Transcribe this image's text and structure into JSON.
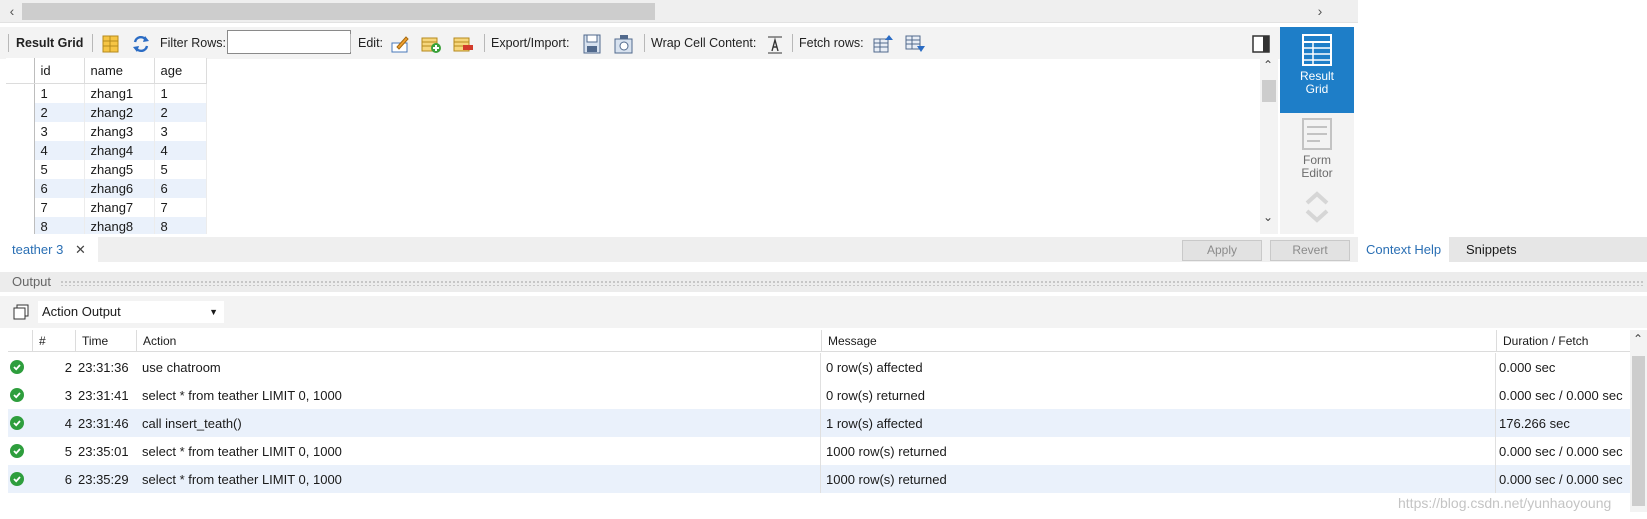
{
  "toolbar": {
    "result_grid": "Result Grid",
    "filter_rows": "Filter Rows:",
    "filter_value": "",
    "edit": "Edit:",
    "export_import": "Export/Import:",
    "wrap_cell": "Wrap Cell Content:",
    "fetch_rows": "Fetch rows:"
  },
  "grid": {
    "columns": [
      "id",
      "name",
      "age"
    ],
    "rows": [
      [
        "1",
        "zhang1",
        "1"
      ],
      [
        "2",
        "zhang2",
        "2"
      ],
      [
        "3",
        "zhang3",
        "3"
      ],
      [
        "4",
        "zhang4",
        "4"
      ],
      [
        "5",
        "zhang5",
        "5"
      ],
      [
        "6",
        "zhang6",
        "6"
      ],
      [
        "7",
        "zhang7",
        "7"
      ],
      [
        "8",
        "zhang8",
        "8"
      ]
    ]
  },
  "side_panel": {
    "result_grid_line1": "Result",
    "result_grid_line2": "Grid",
    "form_editor_line1": "Form",
    "form_editor_line2": "Editor"
  },
  "tabs": {
    "query_tab": "teather 3",
    "apply": "Apply",
    "revert": "Revert",
    "context_help": "Context Help",
    "snippets": "Snippets"
  },
  "output": {
    "title": "Output",
    "mode": "Action Output",
    "columns": [
      "#",
      "Time",
      "Action",
      "Message",
      "Duration / Fetch"
    ],
    "rows": [
      {
        "num": "2",
        "time": "23:31:36",
        "action": "use chatroom",
        "message": "0 row(s) affected",
        "duration": "0.000 sec"
      },
      {
        "num": "3",
        "time": "23:31:41",
        "action": "select * from teather LIMIT 0, 1000",
        "message": "0 row(s) returned",
        "duration": "0.000 sec / 0.000 sec"
      },
      {
        "num": "4",
        "time": "23:31:46",
        "action": "call insert_teath()",
        "message": "1 row(s) affected",
        "duration": "176.266 sec"
      },
      {
        "num": "5",
        "time": "23:35:01",
        "action": "select * from teather LIMIT 0, 1000",
        "message": "1000 row(s) returned",
        "duration": "0.000 sec / 0.000 sec"
      },
      {
        "num": "6",
        "time": "23:35:29",
        "action": "select * from teather LIMIT 0, 1000",
        "message": "1000 row(s) returned",
        "duration": "0.000 sec / 0.000 sec"
      }
    ]
  },
  "watermark": "https://blog.csdn.net/yunhaoyoung",
  "colors": {
    "accent": "#1e7ec8",
    "success": "#2e9e3d",
    "alt_row": "#eaf1fb"
  }
}
